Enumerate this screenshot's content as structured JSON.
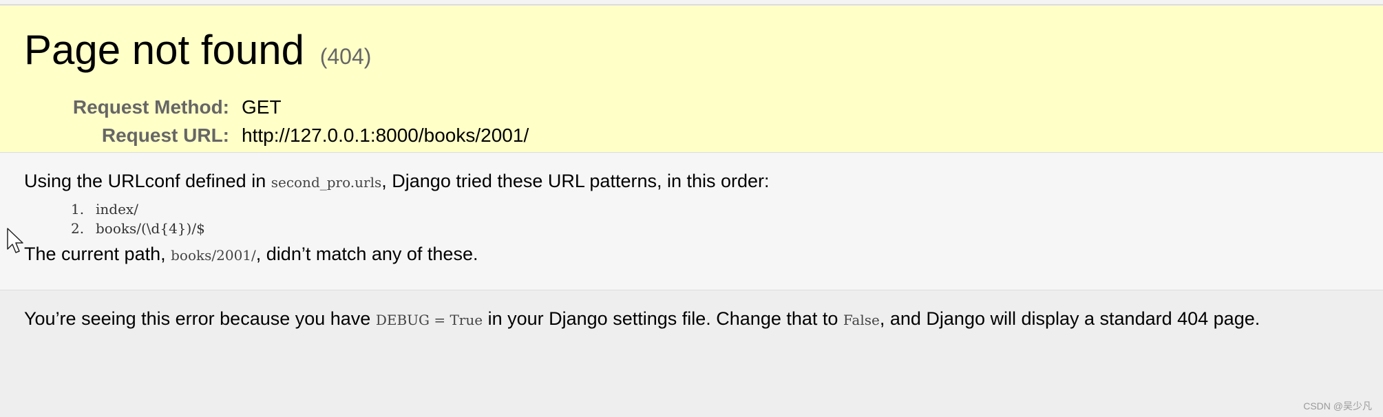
{
  "summary": {
    "title": "Page not found",
    "status_code": "(404)",
    "request_method_label": "Request Method:",
    "request_method_value": "GET",
    "request_url_label": "Request URL:",
    "request_url_value": "http://127.0.0.1:8000/books/2001/"
  },
  "info": {
    "intro_prefix": "Using the URLconf defined in ",
    "urlconf": "second_pro.urls",
    "intro_suffix": ", Django tried these URL patterns, in this order:",
    "patterns": [
      {
        "num": "1.",
        "pattern": "index/"
      },
      {
        "num": "2.",
        "pattern": "books/(\\d{4})/$"
      }
    ],
    "current_path_prefix": "The current path, ",
    "current_path": "books/2001/",
    "current_path_suffix": ", didn’t match any of these."
  },
  "explanation": {
    "part1": "You’re seeing this error because you have ",
    "debug_code": "DEBUG = True",
    "part2": " in your Django settings file. Change that to ",
    "false_code": "False",
    "part3": ", and Django will display a standard 404 page."
  },
  "watermark": "CSDN @吴少凡",
  "colors": {
    "summary_bg": "#ffffc8",
    "info_bg": "#f6f6f6",
    "explanation_bg": "#eeeeee"
  },
  "cursor_icon": "mouse-pointer-icon"
}
